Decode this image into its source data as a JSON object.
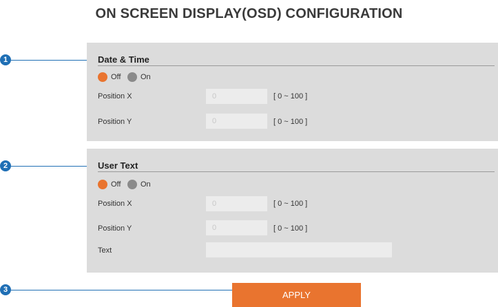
{
  "title": "ON SCREEN DISPLAY(OSD) CONFIGURATION",
  "callouts": [
    "1",
    "2",
    "3"
  ],
  "date_time": {
    "title": "Date & Time",
    "radio_off": "Off",
    "radio_on": "On",
    "selected": "Off",
    "position_x": {
      "label": "Position X",
      "value": "0",
      "range": "[ 0 ~ 100 ]"
    },
    "position_y": {
      "label": "Position Y",
      "value": "0",
      "range": "[ 0 ~ 100 ]"
    }
  },
  "user_text": {
    "title": "User Text",
    "radio_off": "Off",
    "radio_on": "On",
    "selected": "Off",
    "position_x": {
      "label": "Position X",
      "value": "0",
      "range": "[ 0 ~ 100 ]"
    },
    "position_y": {
      "label": "Position Y",
      "value": "0",
      "range": "[ 0 ~ 100 ]"
    },
    "text": {
      "label": "Text",
      "value": ""
    }
  },
  "apply_label": "APPLY",
  "colors": {
    "accent": "#e9742f",
    "callout": "#1f6fb5",
    "panel": "#dcdcdc"
  }
}
